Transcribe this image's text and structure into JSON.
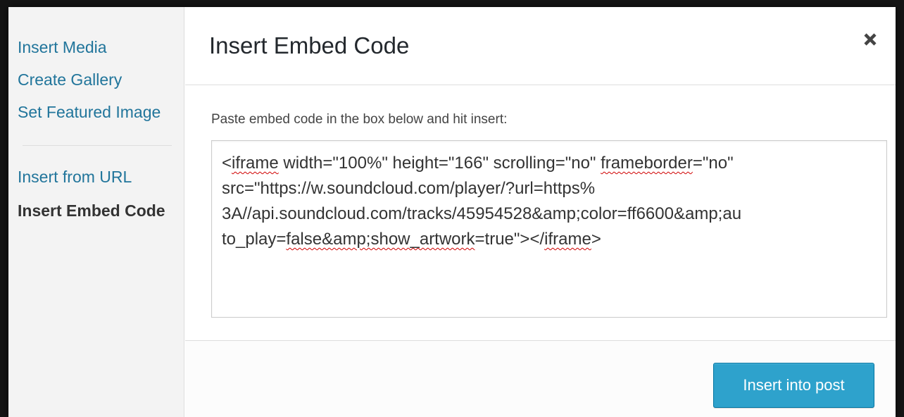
{
  "sidebar": {
    "items": [
      {
        "label": "Insert Media"
      },
      {
        "label": "Create Gallery"
      },
      {
        "label": "Set Featured Image"
      },
      {
        "label": "Insert from URL"
      },
      {
        "label": "Insert Embed Code"
      }
    ],
    "active_item": "Insert Embed Code"
  },
  "dialog": {
    "title": "Insert Embed Code",
    "close_icon": "close-icon",
    "instructions": "Paste embed code in the box below and hit insert:",
    "embed_code_lines": [
      [
        "<",
        "iframe",
        " width=\"100%\" height=\"166\" scrolling=\"no\" ",
        "frameborder",
        "=\"no\""
      ],
      [
        "src=\"https://w.soundcloud.com/player/?url=https%"
      ],
      [
        "3A//api.soundcloud.com/tracks/45954528&amp;color=ff6600&amp;au"
      ],
      [
        "to_play=",
        "false&amp;show_artwork",
        "=true\"></",
        "iframe",
        ">"
      ]
    ],
    "insert_button_label": "Insert into post"
  },
  "colors": {
    "link": "#21759b",
    "primary_button": "#2ea2cc",
    "spellcheck_underline": "#d00000"
  }
}
